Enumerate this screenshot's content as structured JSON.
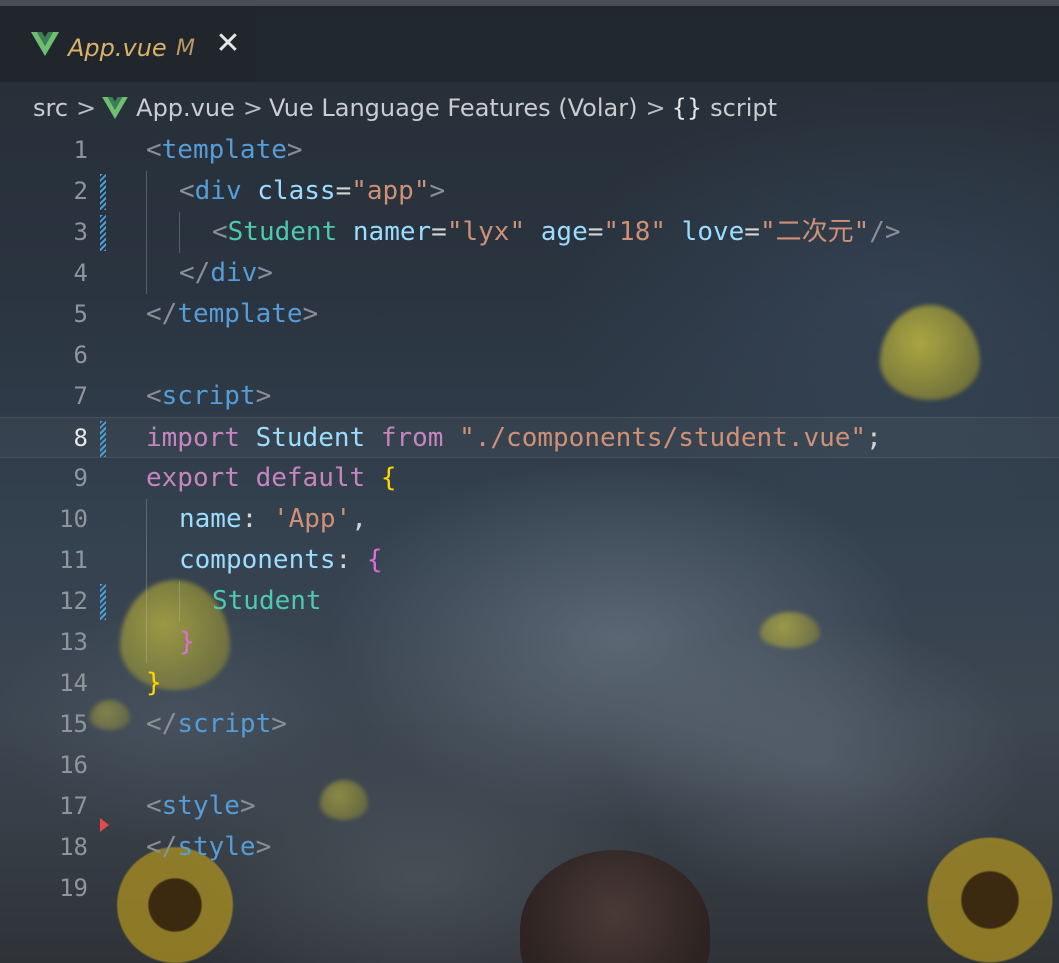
{
  "tab": {
    "title": "App.vue",
    "status": "M",
    "close": "✕"
  },
  "breadcrumb": {
    "items": [
      "src",
      "App.vue",
      "Vue Language Features (Volar)",
      "script"
    ],
    "separator": ">",
    "brace": "{}"
  },
  "editor": {
    "active_line": 8,
    "line_numbers": [
      "1",
      "2",
      "3",
      "4",
      "5",
      "6",
      "7",
      "8",
      "9",
      "10",
      "11",
      "12",
      "13",
      "14",
      "15",
      "16",
      "17",
      "18",
      "19"
    ],
    "lines": {
      "l1": [
        "<",
        "template",
        ">"
      ],
      "l2": [
        "<",
        "div",
        " ",
        "class",
        "=",
        "\"app\"",
        ">"
      ],
      "l3": [
        "<",
        "Student",
        " ",
        "namer",
        "=",
        "\"lyx\"",
        " ",
        "age",
        "=",
        "\"18\"",
        " ",
        "love",
        "=",
        "\"二次元\"",
        "/>"
      ],
      "l4": [
        "</",
        "div",
        ">"
      ],
      "l5": [
        "</",
        "template",
        ">"
      ],
      "l7": [
        "<",
        "script",
        ">"
      ],
      "l8": [
        "import",
        " ",
        "Student",
        " ",
        "from",
        " ",
        "\"./components/student.vue\"",
        ";"
      ],
      "l9": [
        "export",
        " ",
        "default",
        " ",
        "{"
      ],
      "l10": [
        "name",
        ": ",
        "'App'",
        ","
      ],
      "l11": [
        "components",
        ": ",
        "{"
      ],
      "l12": [
        "Student"
      ],
      "l13": [
        "}"
      ],
      "l14": [
        "}"
      ],
      "l15": [
        "</",
        "script",
        ">"
      ],
      "l17": [
        "<",
        "style",
        ">"
      ],
      "l18": [
        "</",
        "style",
        ">"
      ]
    }
  },
  "colors": {
    "tag": "#569cd6",
    "component": "#4ec9b0",
    "attribute": "#9cdcfe",
    "string": "#ce9178",
    "keyword": "#c586c0",
    "bracket_gold": "#ffd700",
    "bracket_orchid": "#da70d6",
    "tab_title": "#d9b26b",
    "error_marker": "#e5484d",
    "modified_marker": "#4aa0d8"
  },
  "icons": {
    "tab_icon": "vue-icon",
    "breadcrumb_icon": "vue-icon",
    "close": "close-icon",
    "symbol": "braces-icon"
  }
}
